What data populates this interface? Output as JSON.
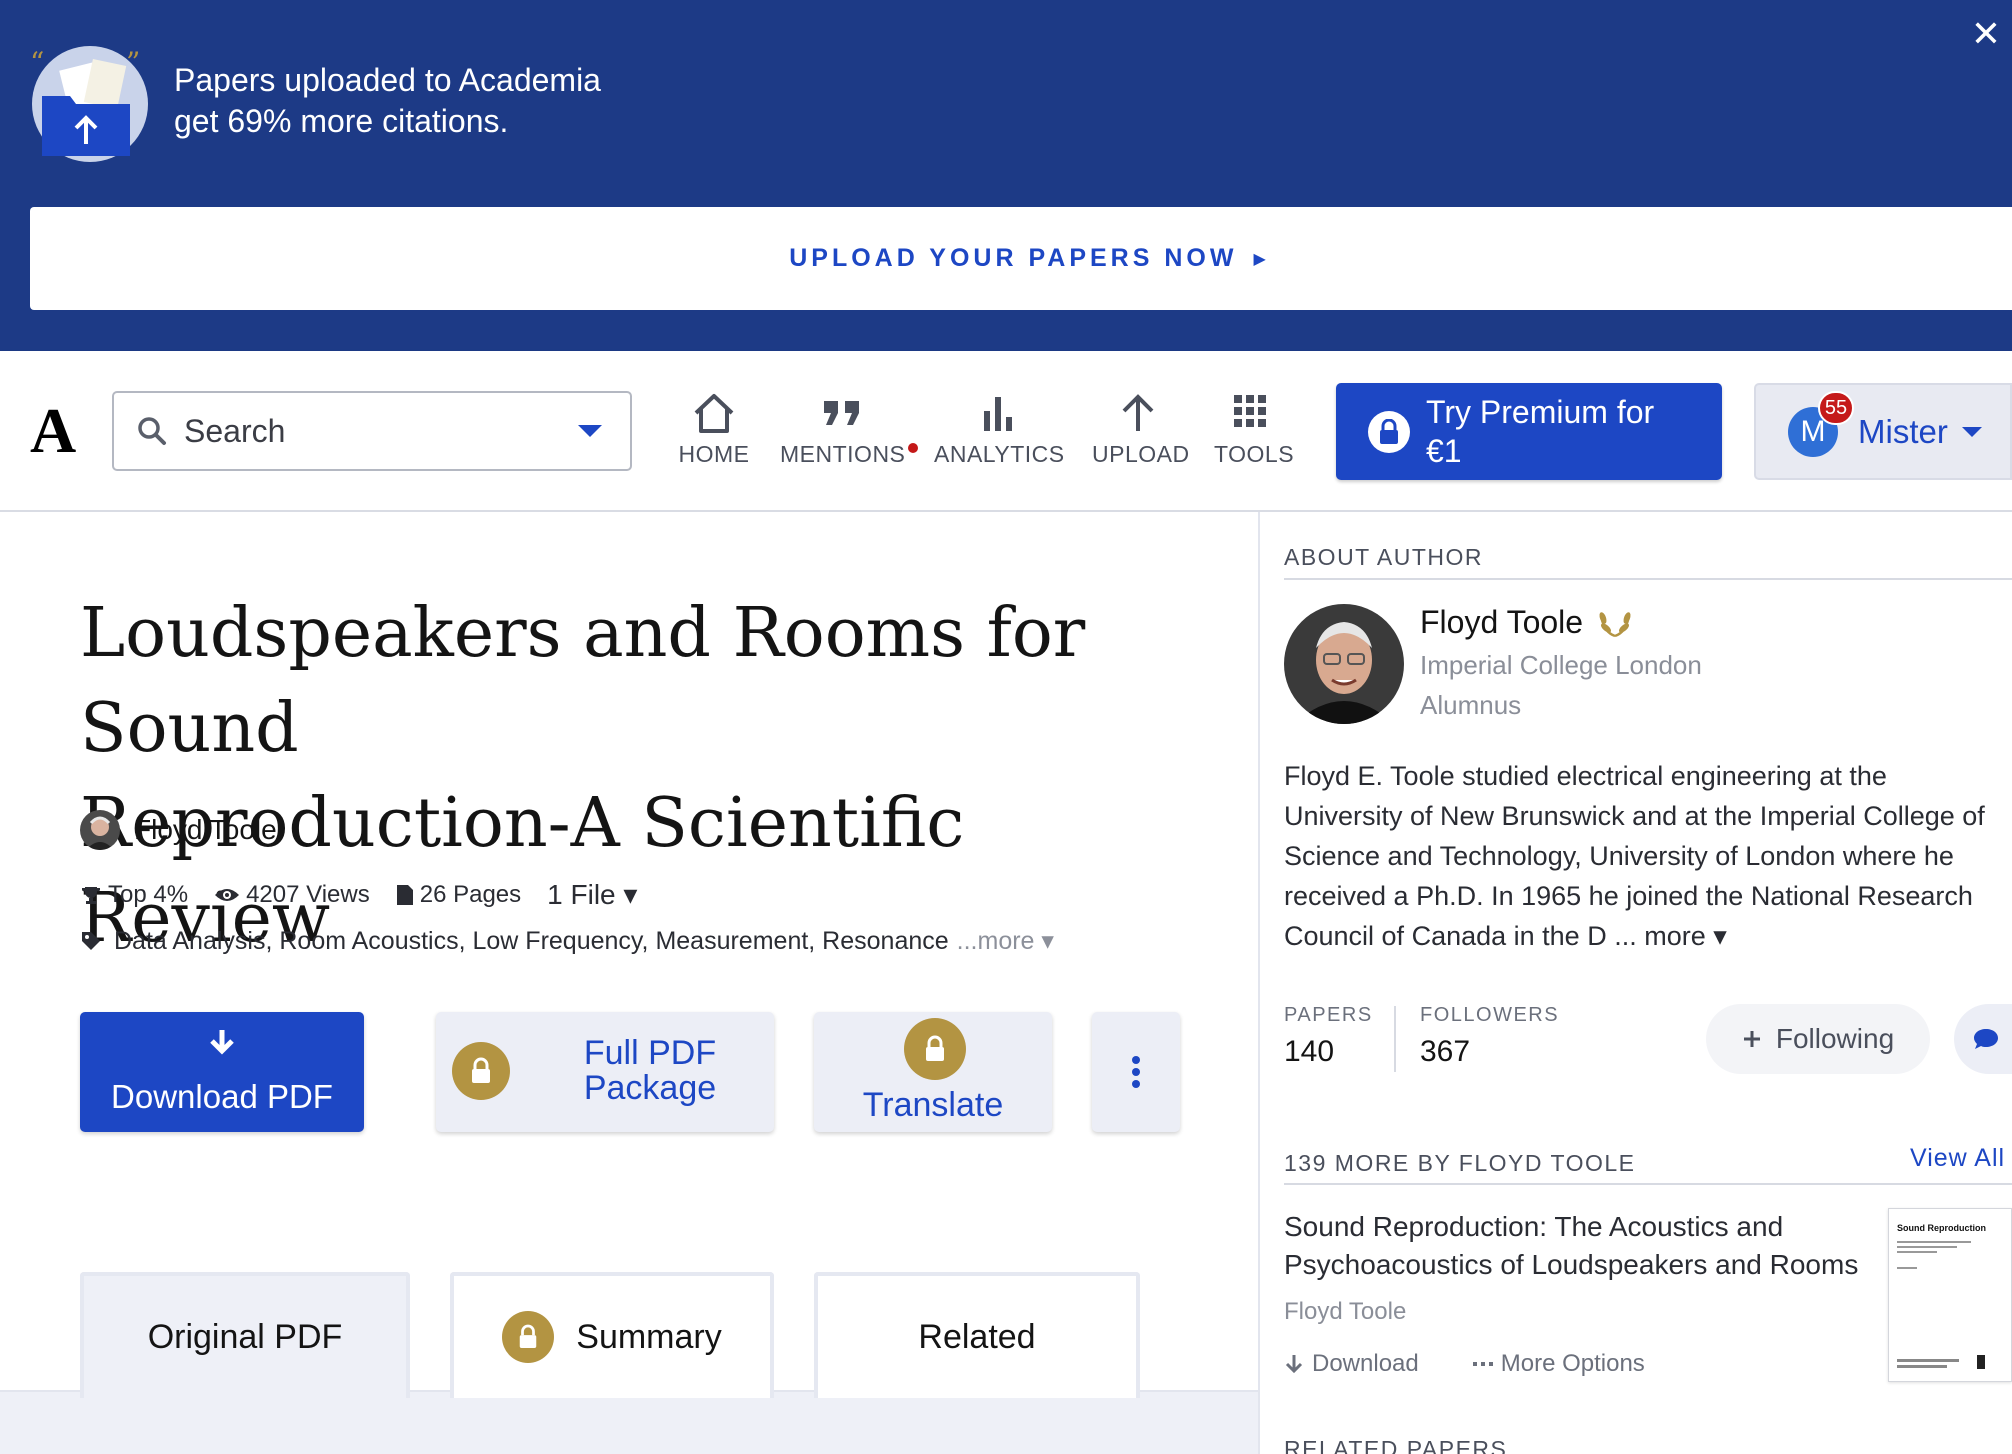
{
  "banner": {
    "line1": "Papers uploaded to Academia",
    "line2": "get 69% more citations.",
    "cta": "UPLOAD YOUR PAPERS NOW",
    "close_glyph": "✕"
  },
  "nav": {
    "logo": "A",
    "search_placeholder": "Search",
    "items": [
      {
        "label": "HOME",
        "icon": "home-icon"
      },
      {
        "label": "MENTIONS",
        "icon": "quote-icon"
      },
      {
        "label": "ANALYTICS",
        "icon": "bar-chart-icon"
      },
      {
        "label": "UPLOAD",
        "icon": "upload-arrow-icon"
      },
      {
        "label": "TOOLS",
        "icon": "grid-icon"
      }
    ],
    "premium_label": "Try Premium for €1",
    "user": {
      "initial": "M",
      "name": "Mister",
      "notifications": "55"
    }
  },
  "paper": {
    "title_line1": "Loudspeakers and Rooms for Sound",
    "title_line2": "Reproduction-A Scientific Review",
    "author": "Floyd Toole",
    "rank": "Top 4%",
    "views": "4207 Views",
    "pages": "26 Pages",
    "files": "1 File ▾",
    "tags": "Data Analysis, Room Acoustics, Low Frequency, Measurement, Resonance",
    "tags_more": "...more ▾",
    "buttons": {
      "download": "Download PDF",
      "package_line1": "Full PDF",
      "package_line2": "Package",
      "translate": "Translate"
    },
    "tabs": [
      "Original PDF",
      "Summary",
      "Related"
    ]
  },
  "sidebar": {
    "about_header": "ABOUT AUTHOR",
    "author_name": "Floyd Toole",
    "affiliation_line1": "Imperial College London",
    "affiliation_line2": "Alumnus",
    "bio": "Floyd E. Toole studied electrical engineering at the University of New Brunswick and at the Imperial College of Science and Technology, University of London where he received a Ph.D. In 1965 he joined the National Research Council of Canada in the D ... ",
    "bio_more": "more ▾",
    "papers_label": "PAPERS",
    "papers_count": "140",
    "followers_label": "FOLLOWERS",
    "followers_count": "367",
    "follow_label": "Following",
    "more_by_header": "139 MORE BY FLOYD TOOLE",
    "view_all": "View All",
    "related_paper": {
      "title": "Sound Reproduction: The Acoustics and Psychoacoustics of Loudspeakers and Rooms",
      "author": "Floyd Toole",
      "download": "Download",
      "more_options": "More Options",
      "thumb_title": "Sound Reproduction"
    },
    "related_header": "RELATED PAPERS"
  },
  "colors": {
    "banner_bg": "#1d3a86",
    "brand_blue": "#1d47c4",
    "gold": "#b39442",
    "notification_red": "#c51a1a"
  }
}
